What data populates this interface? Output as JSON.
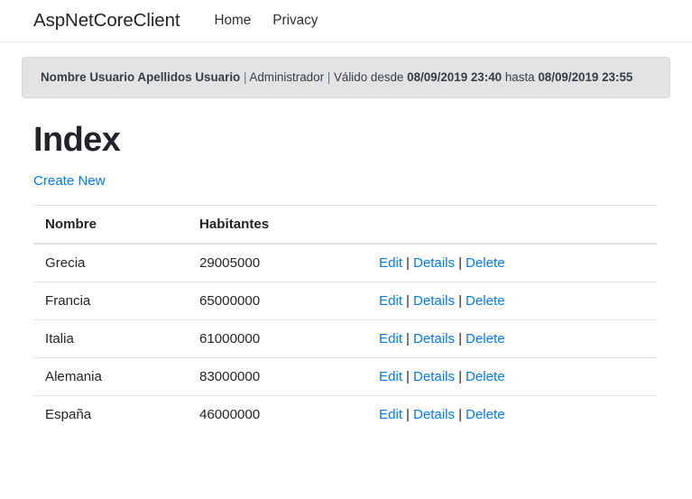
{
  "navbar": {
    "brand": "AspNetCoreClient",
    "links": [
      {
        "label": "Home"
      },
      {
        "label": "Privacy"
      }
    ]
  },
  "alert": {
    "user_name": "Nombre Usuario Apellidos Usuario",
    "separator": "|",
    "role": "Administrador",
    "valid_from_label": "Válido desde",
    "valid_from_value": "08/09/2019 23:40",
    "valid_to_label": "hasta",
    "valid_to_value": "08/09/2019 23:55",
    "background_color": "#e2e3e5",
    "border_color": "#d6d8db"
  },
  "main": {
    "page_title": "Index",
    "create_new_label": "Create New",
    "link_color": "#007bff"
  },
  "table": {
    "columns": [
      "Nombre",
      "Habitantes",
      ""
    ],
    "action_labels": {
      "edit": "Edit",
      "details": "Details",
      "delete": "Delete",
      "separator": "|"
    },
    "rows": [
      {
        "nombre": "Grecia",
        "habitantes": "29005000"
      },
      {
        "nombre": "Francia",
        "habitantes": "65000000"
      },
      {
        "nombre": "Italia",
        "habitantes": "61000000"
      },
      {
        "nombre": "Alemania",
        "habitantes": "83000000"
      },
      {
        "nombre": "España",
        "habitantes": "46000000"
      }
    ]
  }
}
